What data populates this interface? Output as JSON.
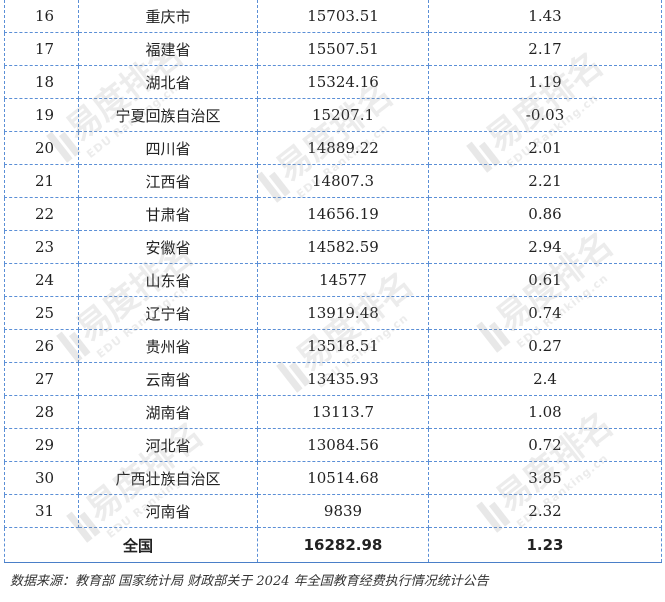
{
  "table": {
    "rows": [
      {
        "rank": "16",
        "province": "重庆市",
        "value": "15703.51",
        "rate": "1.43"
      },
      {
        "rank": "17",
        "province": "福建省",
        "value": "15507.51",
        "rate": "2.17"
      },
      {
        "rank": "18",
        "province": "湖北省",
        "value": "15324.16",
        "rate": "1.19"
      },
      {
        "rank": "19",
        "province": "宁夏回族自治区",
        "value": "15207.1",
        "rate": "-0.03"
      },
      {
        "rank": "20",
        "province": "四川省",
        "value": "14889.22",
        "rate": "2.01"
      },
      {
        "rank": "21",
        "province": "江西省",
        "value": "14807.3",
        "rate": "2.21"
      },
      {
        "rank": "22",
        "province": "甘肃省",
        "value": "14656.19",
        "rate": "0.86"
      },
      {
        "rank": "23",
        "province": "安徽省",
        "value": "14582.59",
        "rate": "2.94"
      },
      {
        "rank": "24",
        "province": "山东省",
        "value": "14577",
        "rate": "0.61"
      },
      {
        "rank": "25",
        "province": "辽宁省",
        "value": "13919.48",
        "rate": "0.74"
      },
      {
        "rank": "26",
        "province": "贵州省",
        "value": "13518.51",
        "rate": "0.27"
      },
      {
        "rank": "27",
        "province": "云南省",
        "value": "13435.93",
        "rate": "2.4"
      },
      {
        "rank": "28",
        "province": "湖南省",
        "value": "13113.7",
        "rate": "1.08"
      },
      {
        "rank": "29",
        "province": "河北省",
        "value": "13084.56",
        "rate": "0.72"
      },
      {
        "rank": "30",
        "province": "广西壮族自治区",
        "value": "10514.68",
        "rate": "3.85"
      },
      {
        "rank": "31",
        "province": "河南省",
        "value": "9839",
        "rate": "2.32"
      }
    ],
    "total": {
      "label": "全国",
      "value": "16282.98",
      "rate": "1.23"
    }
  },
  "source": "数据来源：教育部 国家统计局 财政部关于 2024 年全国教育经费执行情况统计公告",
  "watermark": {
    "text": "易度排名",
    "sub": "EDU Ranking.cn"
  },
  "colors": {
    "border": "#5b8fd6",
    "watermark": "#969696"
  }
}
